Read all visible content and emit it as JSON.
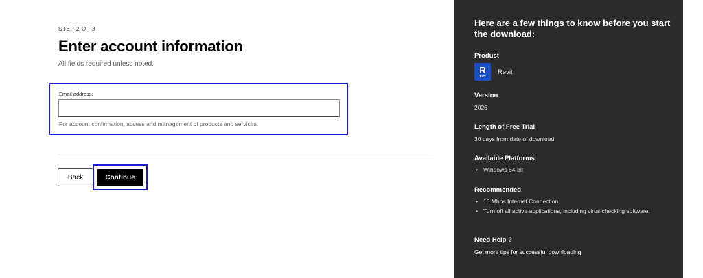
{
  "form": {
    "step": "STEP 2 OF 3",
    "title": "Enter account information",
    "subtitle": "All fields required unless noted.",
    "email": {
      "label": "Email address:",
      "value": "",
      "placeholder": "",
      "help": "For account confirmation, access and management of products and services."
    },
    "back_label": "Back",
    "continue_label": "Continue"
  },
  "panel": {
    "title": "Here are a few things to know before you start the download:",
    "product": {
      "heading": "Product",
      "icon_letter": "R",
      "icon_code": "RVT",
      "name": "Revit"
    },
    "version": {
      "heading": "Version",
      "value": "2026"
    },
    "trial": {
      "heading": "Length of Free Trial",
      "value": "30 days from date of download"
    },
    "platforms": {
      "heading": "Available Platforms",
      "items": [
        "Windows 64-bit"
      ]
    },
    "recommended": {
      "heading": "Recommended",
      "items": [
        "10 Mbps Internet Connection.",
        "Turn off all active applications, including virus checking software."
      ]
    },
    "help": {
      "heading": "Need Help ?",
      "link": "Get more tips for successful downloading"
    }
  },
  "colors": {
    "panel_bg": "#2b2b2b",
    "focus_outline": "#1a1ad6",
    "primary_button": "#000000",
    "product_icon": "#1b4fc8"
  }
}
